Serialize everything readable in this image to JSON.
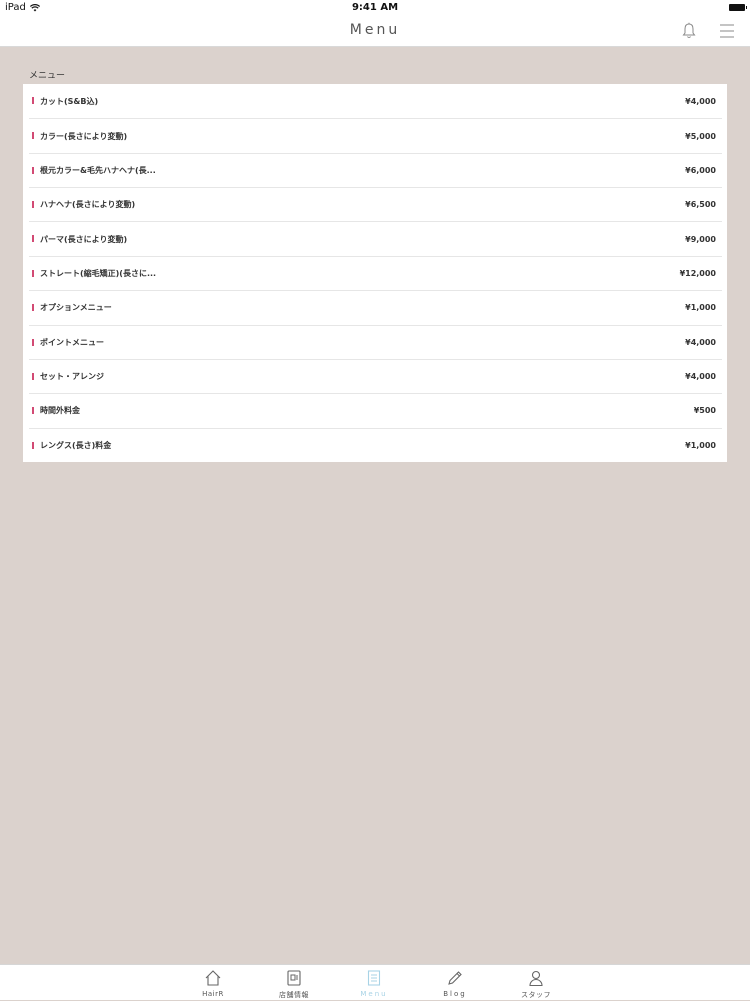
{
  "status_bar": {
    "device": "iPad",
    "time": "9:41 AM"
  },
  "nav": {
    "title": "Menu"
  },
  "section": {
    "label": "メニュー"
  },
  "menu_items": [
    {
      "name": "カット(S&B込)",
      "price": "¥4,000"
    },
    {
      "name": "カラー(長さにより変動)",
      "price": "¥5,000"
    },
    {
      "name": "根元カラー&毛先ハナヘナ(長...",
      "price": "¥6,000"
    },
    {
      "name": "ハナヘナ(長さにより変動)",
      "price": "¥6,500"
    },
    {
      "name": "パーマ(長さにより変動)",
      "price": "¥9,000"
    },
    {
      "name": "ストレート(縮毛矯正)(長さに...",
      "price": "¥12,000"
    },
    {
      "name": "オプションメニュー",
      "price": "¥1,000"
    },
    {
      "name": "ポイントメニュー",
      "price": "¥4,000"
    },
    {
      "name": "セット・アレンジ",
      "price": "¥4,000"
    },
    {
      "name": "時間外料金",
      "price": "¥500"
    },
    {
      "name": "レングス(長さ)料金",
      "price": "¥1,000"
    }
  ],
  "tabs": [
    {
      "label": "HairR",
      "icon": "home-icon"
    },
    {
      "label": "店舗情報",
      "icon": "shop-info-icon"
    },
    {
      "label": "Menu",
      "icon": "menu-list-icon",
      "active": true
    },
    {
      "label": "Blog",
      "icon": "pencil-icon"
    },
    {
      "label": "スタッフ",
      "icon": "person-icon"
    }
  ],
  "colors": {
    "background": "#dbd2cd",
    "accent": "#d24a74",
    "active_tab": "#a8d3e6"
  }
}
